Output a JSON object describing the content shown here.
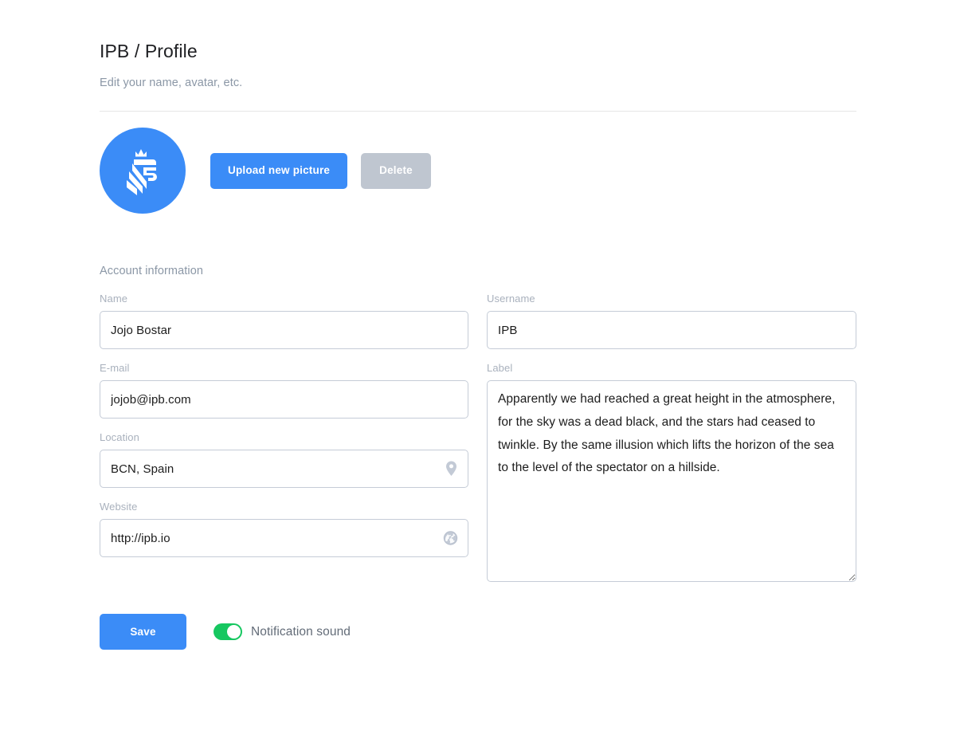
{
  "header": {
    "title": "IPB / Profile",
    "subtitle": "Edit your name, avatar, etc."
  },
  "avatar": {
    "icon": "lion-crest-icon",
    "upload_label": "Upload new picture",
    "delete_label": "Delete"
  },
  "account": {
    "section_title": "Account information",
    "fields": {
      "name": {
        "label": "Name",
        "value": "Jojo Bostar"
      },
      "username": {
        "label": "Username",
        "value": "IPB"
      },
      "email": {
        "label": "E-mail",
        "value": "jojob@ipb.com"
      },
      "location": {
        "label": "Location",
        "value": "BCN, Spain",
        "icon": "map-pin-icon"
      },
      "website": {
        "label": "Website",
        "value": "http://ipb.io",
        "icon": "globe-icon"
      },
      "bio": {
        "label": "Label",
        "value": "Apparently we had reached a great height in the atmosphere, for the sky was a dead black, and the stars had ceased to twinkle. By the same illusion which lifts the horizon of the sea to the level of the spectator on a hillside."
      }
    }
  },
  "footer": {
    "save_label": "Save",
    "notification_label": "Notification sound",
    "notification_enabled": true
  },
  "colors": {
    "accent_blue": "#3b8cf7",
    "muted_gray": "#bfc6d0",
    "toggle_green": "#16c760",
    "border": "#c5ccd7",
    "label_gray": "#a9b1bd"
  }
}
